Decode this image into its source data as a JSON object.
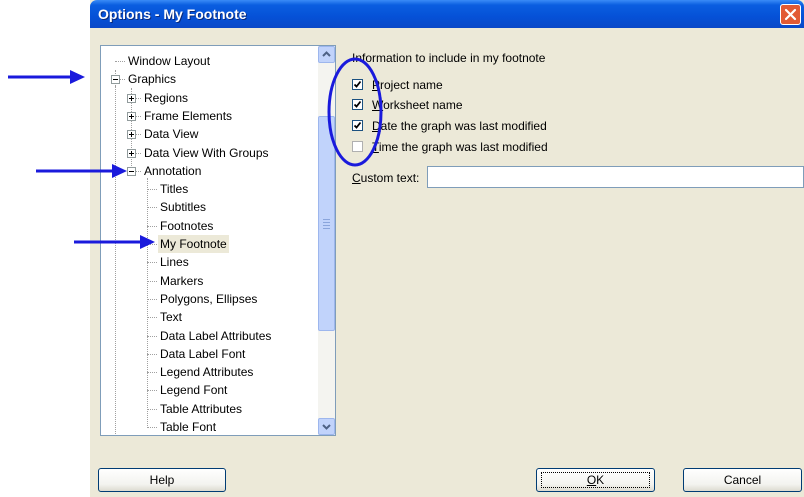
{
  "window": {
    "title": "Options - My Footnote"
  },
  "tree": {
    "items": [
      {
        "label": "Window Layout",
        "level": 0,
        "expander": "none"
      },
      {
        "label": "Graphics",
        "level": 0,
        "expander": "minus"
      },
      {
        "label": "Regions",
        "level": 1,
        "expander": "plus"
      },
      {
        "label": "Frame Elements",
        "level": 1,
        "expander": "plus"
      },
      {
        "label": "Data View",
        "level": 1,
        "expander": "plus"
      },
      {
        "label": "Data View With Groups",
        "level": 1,
        "expander": "plus"
      },
      {
        "label": "Annotation",
        "level": 1,
        "expander": "minus"
      },
      {
        "label": "Titles",
        "level": 2
      },
      {
        "label": "Subtitles",
        "level": 2
      },
      {
        "label": "Footnotes",
        "level": 2
      },
      {
        "label": "My Footnote",
        "level": 2,
        "selected": true
      },
      {
        "label": "Lines",
        "level": 2
      },
      {
        "label": "Markers",
        "level": 2
      },
      {
        "label": "Polygons, Ellipses",
        "level": 2
      },
      {
        "label": "Text",
        "level": 2
      },
      {
        "label": "Data Label Attributes",
        "level": 2
      },
      {
        "label": "Data Label Font",
        "level": 2
      },
      {
        "label": "Legend Attributes",
        "level": 2
      },
      {
        "label": "Legend Font",
        "level": 2
      },
      {
        "label": "Table Attributes",
        "level": 2
      },
      {
        "label": "Table Font",
        "level": 2
      }
    ]
  },
  "content": {
    "info_label": "Information to include in my footnote",
    "options": [
      {
        "first": "P",
        "rest": "roject name",
        "checked": true
      },
      {
        "first": "W",
        "rest": "orksheet name",
        "checked": true
      },
      {
        "first": "D",
        "rest": "ate the graph was last modified",
        "checked": true
      },
      {
        "first": "T",
        "rest": "ime the graph was last modified",
        "checked": false
      }
    ],
    "custom_text_label_first": "C",
    "custom_text_label_rest": "ustom text:",
    "custom_text_value": ""
  },
  "buttons": {
    "help": "Help",
    "ok_first": "O",
    "ok_rest": "K",
    "cancel": "Cancel"
  },
  "colors": {
    "annotation_blue": "#1a1adc",
    "titlebar": "#0551d7",
    "dialog_bg": "#ece9d8"
  }
}
